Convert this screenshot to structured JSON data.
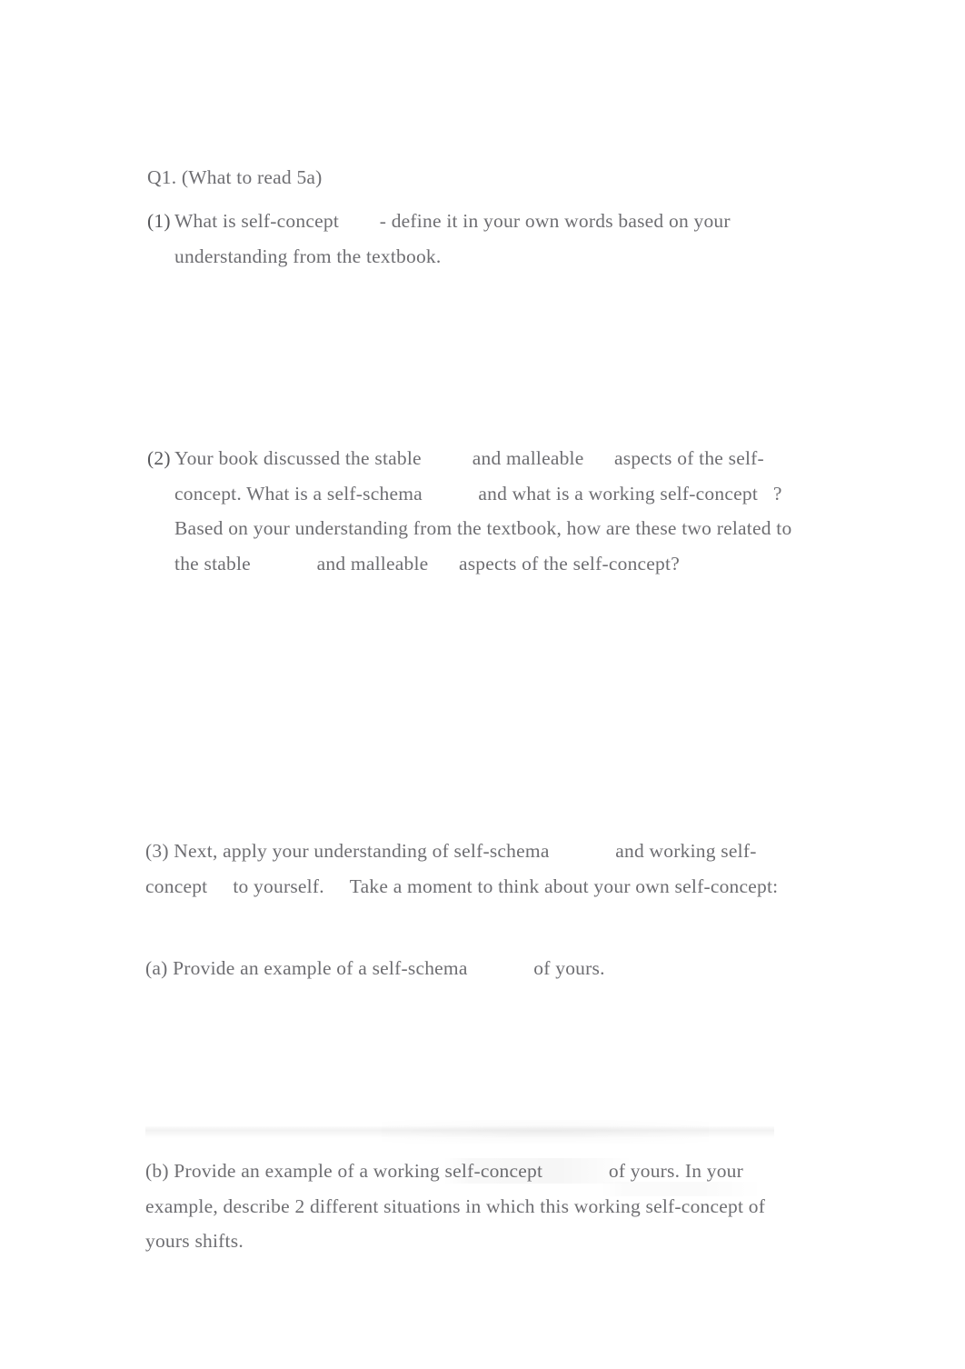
{
  "document": {
    "heading": "Q1. (What to read 5a)",
    "items": [
      {
        "marker": "(1)",
        "style": "hanging",
        "segments": [
          {
            "text": "What is self-concept"
          },
          {
            "gap": "        "
          },
          {
            "text": "- define it in your own words based on your understanding from the textbook."
          }
        ]
      },
      {
        "marker": "(2)",
        "style": "hanging",
        "segments": [
          {
            "text": "Your book discussed the stable"
          },
          {
            "gap": "          "
          },
          {
            "text": "and malleable"
          },
          {
            "gap": "      "
          },
          {
            "text": "aspects of the self-concept. What is a self-schema"
          },
          {
            "gap": "           "
          },
          {
            "text": "and what is a working self-concept"
          },
          {
            "gap": "   "
          },
          {
            "text": "? Based on your understanding from the textbook, how are these two related to the stable"
          },
          {
            "gap": "             "
          },
          {
            "text": "and malleable"
          },
          {
            "gap": "      "
          },
          {
            "text": "aspects of the self-concept?"
          }
        ]
      },
      {
        "marker": "(3)",
        "style": "flush",
        "segments": [
          {
            "text": "(3) Next, apply your understanding of self-schema"
          },
          {
            "gap": "             "
          },
          {
            "text": "and working self-concept"
          },
          {
            "gap": "     "
          },
          {
            "text": "to yourself."
          },
          {
            "gap": "     "
          },
          {
            "text": "Take a moment to think about your own self-concept:"
          }
        ]
      },
      {
        "marker": "(a)",
        "style": "flush",
        "segments": [
          {
            "text": "(a) Provide an example of a self-schema"
          },
          {
            "gap": "             "
          },
          {
            "text": "of yours."
          }
        ]
      },
      {
        "marker": "(b)",
        "style": "flush",
        "segments": [
          {
            "text": "(b) Provide an example of a working self-concept"
          },
          {
            "gap": "             "
          },
          {
            "text": "of yours. In your example, describe 2 different situations in which this working self-concept of yours shifts."
          }
        ]
      }
    ]
  },
  "colors": {
    "page_background": "#ffffff",
    "body_text": "#6e6e72",
    "marker_text": "#57575a"
  }
}
